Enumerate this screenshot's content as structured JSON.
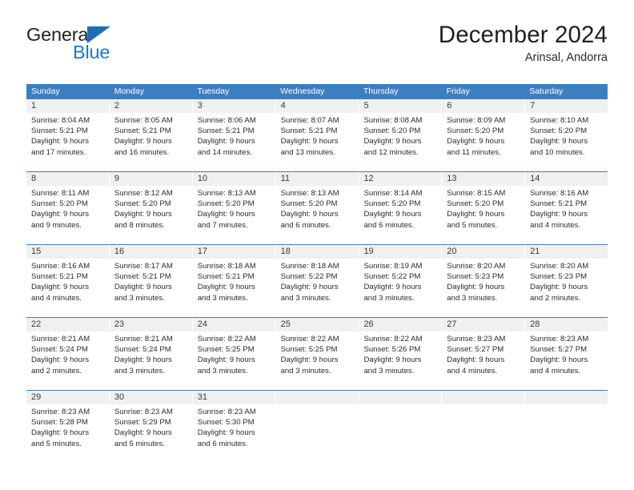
{
  "brand": {
    "name_dark": "General",
    "name_blue": "Blue",
    "accent_blue": "#1e7ac0",
    "header_blue": "#3c7fc0"
  },
  "header": {
    "title": "December 2024",
    "subtitle": "Arinsal, Andorra"
  },
  "calendar": {
    "weekday_headers": [
      "Sunday",
      "Monday",
      "Tuesday",
      "Wednesday",
      "Thursday",
      "Friday",
      "Saturday"
    ],
    "labels": {
      "sunrise_prefix": "Sunrise:",
      "sunset_prefix": "Sunset:",
      "daylight_prefix": "Daylight:"
    },
    "weeks": [
      [
        {
          "day": "1",
          "sunrise": "Sunrise: 8:04 AM",
          "sunset": "Sunset: 5:21 PM",
          "daylight_1": "Daylight: 9 hours",
          "daylight_2": "and 17 minutes."
        },
        {
          "day": "2",
          "sunrise": "Sunrise: 8:05 AM",
          "sunset": "Sunset: 5:21 PM",
          "daylight_1": "Daylight: 9 hours",
          "daylight_2": "and 16 minutes."
        },
        {
          "day": "3",
          "sunrise": "Sunrise: 8:06 AM",
          "sunset": "Sunset: 5:21 PM",
          "daylight_1": "Daylight: 9 hours",
          "daylight_2": "and 14 minutes."
        },
        {
          "day": "4",
          "sunrise": "Sunrise: 8:07 AM",
          "sunset": "Sunset: 5:21 PM",
          "daylight_1": "Daylight: 9 hours",
          "daylight_2": "and 13 minutes."
        },
        {
          "day": "5",
          "sunrise": "Sunrise: 8:08 AM",
          "sunset": "Sunset: 5:20 PM",
          "daylight_1": "Daylight: 9 hours",
          "daylight_2": "and 12 minutes."
        },
        {
          "day": "6",
          "sunrise": "Sunrise: 8:09 AM",
          "sunset": "Sunset: 5:20 PM",
          "daylight_1": "Daylight: 9 hours",
          "daylight_2": "and 11 minutes."
        },
        {
          "day": "7",
          "sunrise": "Sunrise: 8:10 AM",
          "sunset": "Sunset: 5:20 PM",
          "daylight_1": "Daylight: 9 hours",
          "daylight_2": "and 10 minutes."
        }
      ],
      [
        {
          "day": "8",
          "sunrise": "Sunrise: 8:11 AM",
          "sunset": "Sunset: 5:20 PM",
          "daylight_1": "Daylight: 9 hours",
          "daylight_2": "and 9 minutes."
        },
        {
          "day": "9",
          "sunrise": "Sunrise: 8:12 AM",
          "sunset": "Sunset: 5:20 PM",
          "daylight_1": "Daylight: 9 hours",
          "daylight_2": "and 8 minutes."
        },
        {
          "day": "10",
          "sunrise": "Sunrise: 8:13 AM",
          "sunset": "Sunset: 5:20 PM",
          "daylight_1": "Daylight: 9 hours",
          "daylight_2": "and 7 minutes."
        },
        {
          "day": "11",
          "sunrise": "Sunrise: 8:13 AM",
          "sunset": "Sunset: 5:20 PM",
          "daylight_1": "Daylight: 9 hours",
          "daylight_2": "and 6 minutes."
        },
        {
          "day": "12",
          "sunrise": "Sunrise: 8:14 AM",
          "sunset": "Sunset: 5:20 PM",
          "daylight_1": "Daylight: 9 hours",
          "daylight_2": "and 6 minutes."
        },
        {
          "day": "13",
          "sunrise": "Sunrise: 8:15 AM",
          "sunset": "Sunset: 5:20 PM",
          "daylight_1": "Daylight: 9 hours",
          "daylight_2": "and 5 minutes."
        },
        {
          "day": "14",
          "sunrise": "Sunrise: 8:16 AM",
          "sunset": "Sunset: 5:21 PM",
          "daylight_1": "Daylight: 9 hours",
          "daylight_2": "and 4 minutes."
        }
      ],
      [
        {
          "day": "15",
          "sunrise": "Sunrise: 8:16 AM",
          "sunset": "Sunset: 5:21 PM",
          "daylight_1": "Daylight: 9 hours",
          "daylight_2": "and 4 minutes."
        },
        {
          "day": "16",
          "sunrise": "Sunrise: 8:17 AM",
          "sunset": "Sunset: 5:21 PM",
          "daylight_1": "Daylight: 9 hours",
          "daylight_2": "and 3 minutes."
        },
        {
          "day": "17",
          "sunrise": "Sunrise: 8:18 AM",
          "sunset": "Sunset: 5:21 PM",
          "daylight_1": "Daylight: 9 hours",
          "daylight_2": "and 3 minutes."
        },
        {
          "day": "18",
          "sunrise": "Sunrise: 8:18 AM",
          "sunset": "Sunset: 5:22 PM",
          "daylight_1": "Daylight: 9 hours",
          "daylight_2": "and 3 minutes."
        },
        {
          "day": "19",
          "sunrise": "Sunrise: 8:19 AM",
          "sunset": "Sunset: 5:22 PM",
          "daylight_1": "Daylight: 9 hours",
          "daylight_2": "and 3 minutes."
        },
        {
          "day": "20",
          "sunrise": "Sunrise: 8:20 AM",
          "sunset": "Sunset: 5:23 PM",
          "daylight_1": "Daylight: 9 hours",
          "daylight_2": "and 3 minutes."
        },
        {
          "day": "21",
          "sunrise": "Sunrise: 8:20 AM",
          "sunset": "Sunset: 5:23 PM",
          "daylight_1": "Daylight: 9 hours",
          "daylight_2": "and 2 minutes."
        }
      ],
      [
        {
          "day": "22",
          "sunrise": "Sunrise: 8:21 AM",
          "sunset": "Sunset: 5:24 PM",
          "daylight_1": "Daylight: 9 hours",
          "daylight_2": "and 2 minutes."
        },
        {
          "day": "23",
          "sunrise": "Sunrise: 8:21 AM",
          "sunset": "Sunset: 5:24 PM",
          "daylight_1": "Daylight: 9 hours",
          "daylight_2": "and 3 minutes."
        },
        {
          "day": "24",
          "sunrise": "Sunrise: 8:22 AM",
          "sunset": "Sunset: 5:25 PM",
          "daylight_1": "Daylight: 9 hours",
          "daylight_2": "and 3 minutes."
        },
        {
          "day": "25",
          "sunrise": "Sunrise: 8:22 AM",
          "sunset": "Sunset: 5:25 PM",
          "daylight_1": "Daylight: 9 hours",
          "daylight_2": "and 3 minutes."
        },
        {
          "day": "26",
          "sunrise": "Sunrise: 8:22 AM",
          "sunset": "Sunset: 5:26 PM",
          "daylight_1": "Daylight: 9 hours",
          "daylight_2": "and 3 minutes."
        },
        {
          "day": "27",
          "sunrise": "Sunrise: 8:23 AM",
          "sunset": "Sunset: 5:27 PM",
          "daylight_1": "Daylight: 9 hours",
          "daylight_2": "and 4 minutes."
        },
        {
          "day": "28",
          "sunrise": "Sunrise: 8:23 AM",
          "sunset": "Sunset: 5:27 PM",
          "daylight_1": "Daylight: 9 hours",
          "daylight_2": "and 4 minutes."
        }
      ],
      [
        {
          "day": "29",
          "sunrise": "Sunrise: 8:23 AM",
          "sunset": "Sunset: 5:28 PM",
          "daylight_1": "Daylight: 9 hours",
          "daylight_2": "and 5 minutes."
        },
        {
          "day": "30",
          "sunrise": "Sunrise: 8:23 AM",
          "sunset": "Sunset: 5:29 PM",
          "daylight_1": "Daylight: 9 hours",
          "daylight_2": "and 5 minutes."
        },
        {
          "day": "31",
          "sunrise": "Sunrise: 8:23 AM",
          "sunset": "Sunset: 5:30 PM",
          "daylight_1": "Daylight: 9 hours",
          "daylight_2": "and 6 minutes."
        },
        {
          "day": "",
          "sunrise": "",
          "sunset": "",
          "daylight_1": "",
          "daylight_2": ""
        },
        {
          "day": "",
          "sunrise": "",
          "sunset": "",
          "daylight_1": "",
          "daylight_2": ""
        },
        {
          "day": "",
          "sunrise": "",
          "sunset": "",
          "daylight_1": "",
          "daylight_2": ""
        },
        {
          "day": "",
          "sunrise": "",
          "sunset": "",
          "daylight_1": "",
          "daylight_2": ""
        }
      ]
    ]
  }
}
